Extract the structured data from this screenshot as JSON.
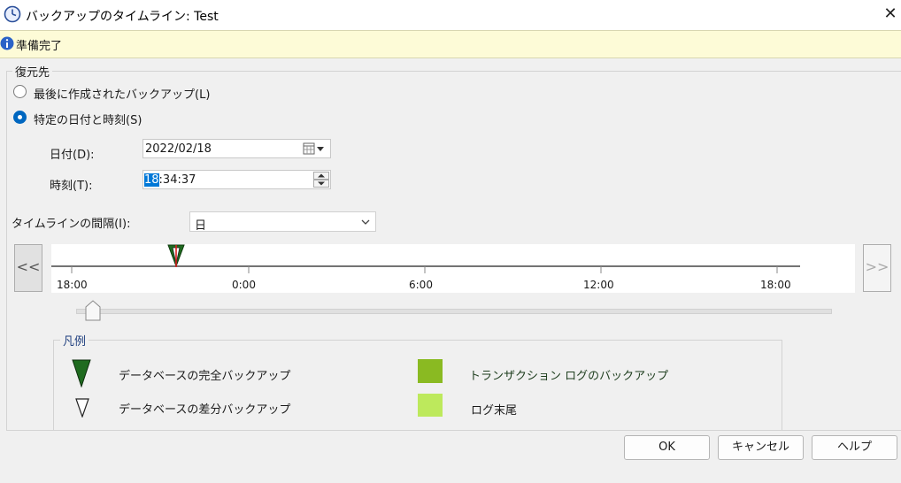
{
  "window": {
    "title": "バックアップのタイムライン: Test",
    "close_glyph": "✕"
  },
  "status": {
    "text": "準備完了"
  },
  "restore": {
    "group_label": "復元先",
    "radio_last": "最後に作成されたバックアップ(L)",
    "radio_specific": "特定の日付と時刻(S)",
    "date_label": "日付(D):",
    "date_value": "2022/02/18",
    "time_label": "時刻(T):",
    "time_hour": "18",
    "time_rest": ":34:37"
  },
  "timeline": {
    "interval_label": "タイムラインの間隔(I):",
    "interval_value": "日",
    "prev_label": "<<",
    "next_label": ">>",
    "ticks": [
      "18:00",
      "0:00",
      "6:00",
      "12:00",
      "18:00"
    ]
  },
  "legend": {
    "title": "凡例",
    "full_backup": "データベースの完全バックアップ",
    "diff_backup": "データベースの差分バックアップ",
    "log_backup": "トランザクション ログのバックアップ",
    "log_tail": "ログ末尾",
    "colors": {
      "full": "#1f6b1f",
      "log": "#8aba22",
      "tail": "#bde95c"
    }
  },
  "buttons": {
    "ok": "OK",
    "cancel": "キャンセル",
    "help": "ヘルプ"
  }
}
